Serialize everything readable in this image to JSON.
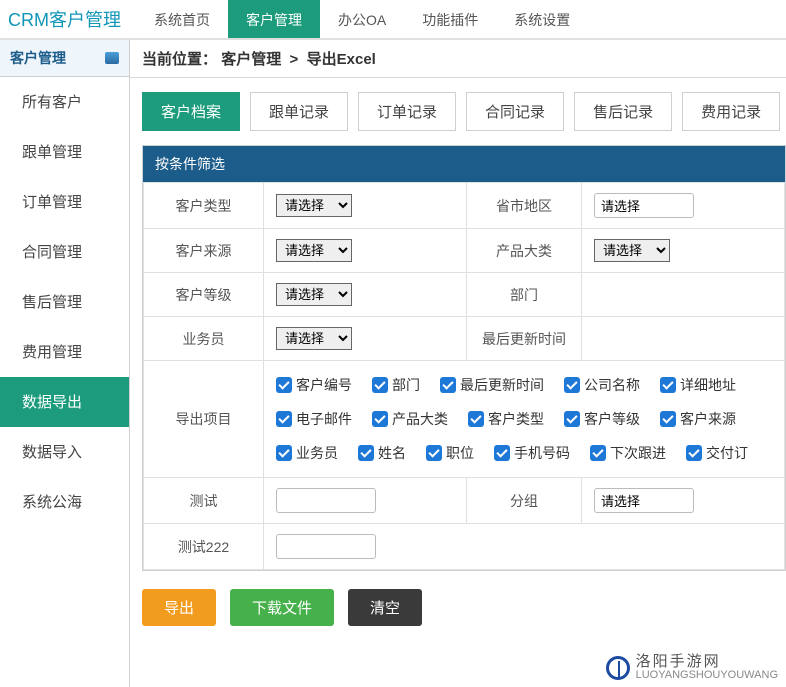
{
  "logo": "CRM客户管理",
  "top_tabs": [
    "系统首页",
    "客户管理",
    "办公OA",
    "功能插件",
    "系统设置"
  ],
  "top_active_index": 1,
  "sidebar": {
    "title": "客户管理",
    "items": [
      "所有客户",
      "跟单管理",
      "订单管理",
      "合同管理",
      "售后管理",
      "费用管理",
      "数据导出",
      "数据导入",
      "系统公海"
    ],
    "active_index": 6
  },
  "breadcrumb": {
    "prefix": "当前位置：",
    "parts": [
      "客户管理",
      "导出Excel"
    ]
  },
  "subtabs": [
    "客户档案",
    "跟单记录",
    "订单记录",
    "合同记录",
    "售后记录",
    "费用记录"
  ],
  "subtab_active_index": 0,
  "panel_title": "按条件筛选",
  "filters": {
    "left": [
      {
        "label": "客户类型",
        "value": "请选择"
      },
      {
        "label": "客户来源",
        "value": "请选择"
      },
      {
        "label": "客户等级",
        "value": "请选择"
      },
      {
        "label": "业务员",
        "value": "请选择"
      }
    ],
    "right": [
      {
        "label": "省市地区",
        "value": "请选择",
        "type": "text"
      },
      {
        "label": "产品大类",
        "value": "请选择"
      },
      {
        "label": "部门",
        "value": ""
      },
      {
        "label": "最后更新时间",
        "value": ""
      }
    ]
  },
  "export": {
    "label": "导出项目",
    "items": [
      "客户编号",
      "部门",
      "最后更新时间",
      "公司名称",
      "详细地址",
      "电子邮件",
      "产品大类",
      "客户类型",
      "客户等级",
      "客户来源",
      "业务员",
      "姓名",
      "职位",
      "手机号码",
      "下次跟进",
      "交付订"
    ]
  },
  "extra_rows": [
    {
      "label": "测试",
      "right_label": "分组",
      "right_value": "请选择"
    },
    {
      "label": "测试222"
    }
  ],
  "actions": {
    "export": "导出",
    "download": "下载文件",
    "clear": "清空"
  },
  "watermark": {
    "brand": "洛阳手游网",
    "domain": "LUOYANGSHOUYOUWANG"
  },
  "colors": {
    "primary": "#1c9c7c",
    "header": "#1c5c8a",
    "accent_orange": "#f29c1f",
    "accent_green": "#46b14a",
    "accent_dark": "#3a3a3a",
    "logo_color": "#1196b8"
  }
}
